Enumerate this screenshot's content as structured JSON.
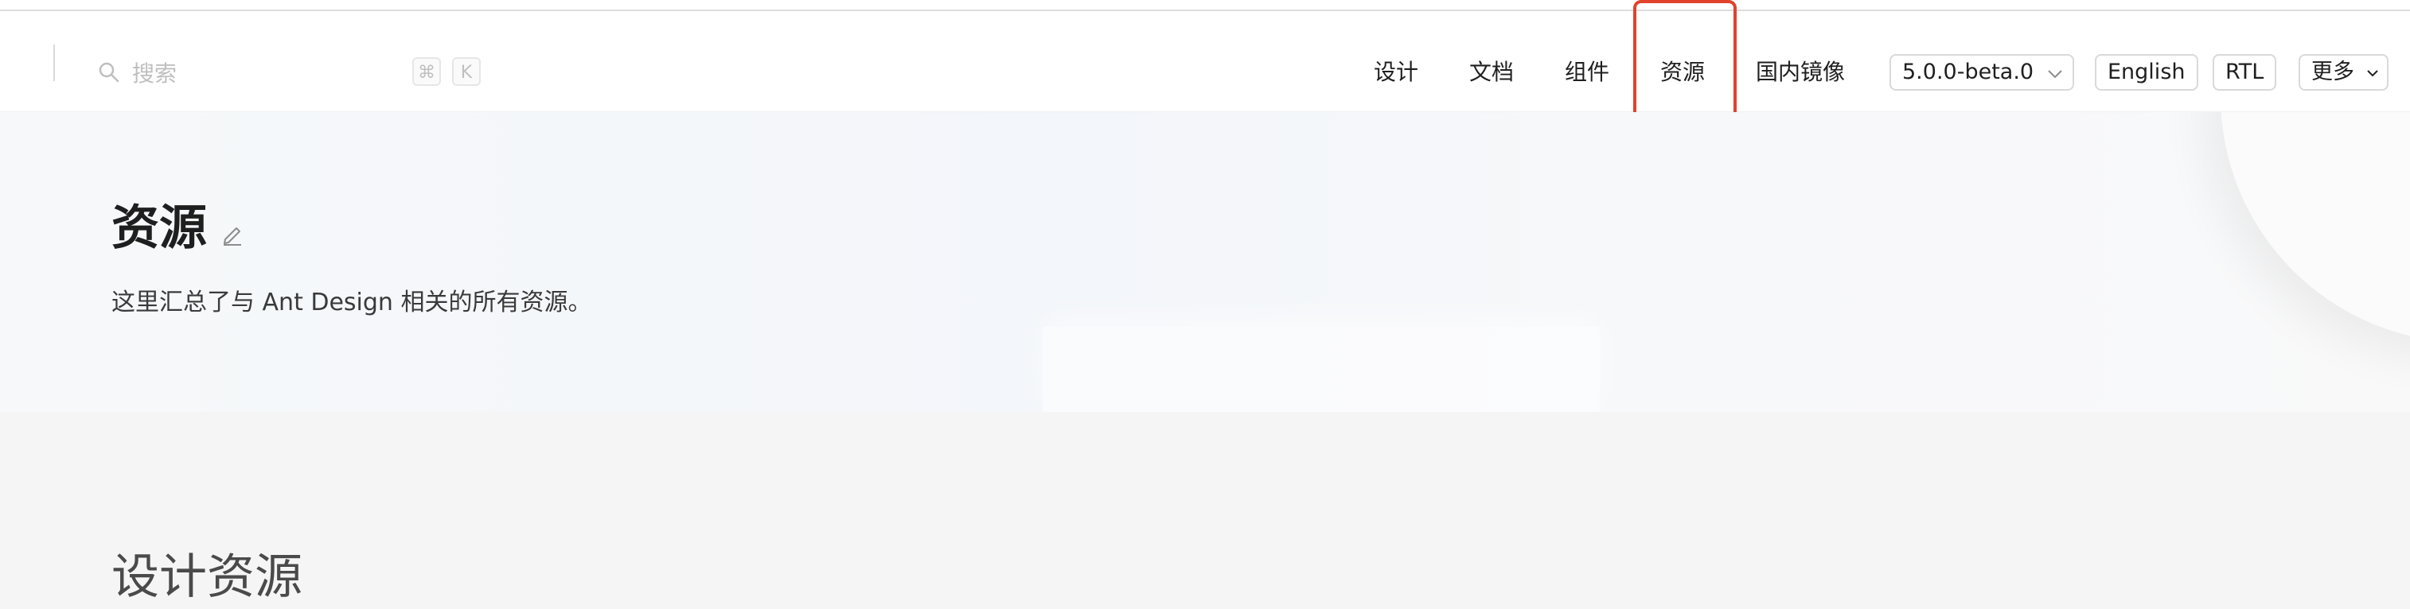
{
  "search": {
    "placeholder": "搜索",
    "shortcut_keys": [
      "⌘",
      "K"
    ]
  },
  "nav": {
    "items": [
      {
        "label": "设计"
      },
      {
        "label": "文档"
      },
      {
        "label": "组件"
      },
      {
        "label": "资源",
        "highlighted": true
      },
      {
        "label": "国内镜像"
      }
    ],
    "version_select": {
      "value": "5.0.0-beta.0"
    },
    "language_button": "English",
    "direction_button": "RTL",
    "more_button": "更多"
  },
  "hero": {
    "title": "资源",
    "description": "这里汇总了与 Ant Design 相关的所有资源。"
  },
  "sections": {
    "design_resources_title": "设计资源"
  },
  "colors": {
    "highlight_border": "#e0422c",
    "text_primary": "#1f1f1f",
    "placeholder": "#bfbfbf"
  }
}
